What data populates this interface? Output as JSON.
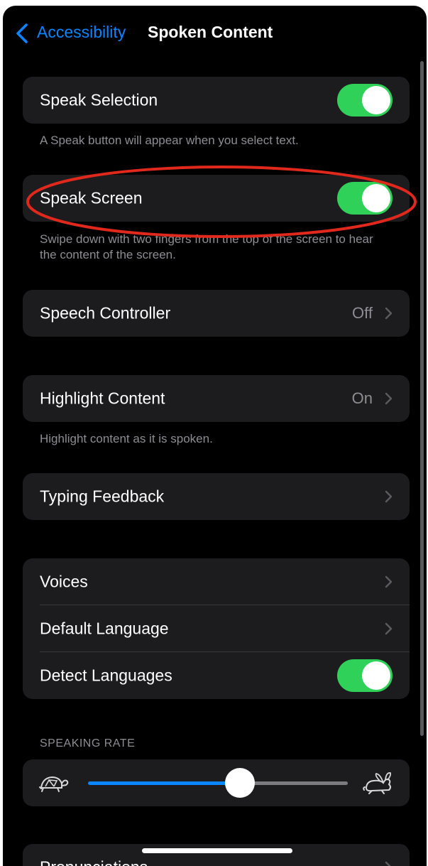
{
  "nav": {
    "back_label": "Accessibility",
    "title": "Spoken Content"
  },
  "speak_selection": {
    "label": "Speak Selection",
    "enabled": true,
    "footer": "A Speak button will appear when you select text."
  },
  "speak_screen": {
    "label": "Speak Screen",
    "enabled": true,
    "footer": "Swipe down with two fingers from the top of the screen to hear the content of the screen."
  },
  "speech_controller": {
    "label": "Speech Controller",
    "value": "Off"
  },
  "highlight_content": {
    "label": "Highlight Content",
    "value": "On",
    "footer": "Highlight content as it is spoken."
  },
  "typing_feedback": {
    "label": "Typing Feedback"
  },
  "voices_group": {
    "voices_label": "Voices",
    "default_language_label": "Default Language",
    "detect_languages_label": "Detect Languages",
    "detect_languages_enabled": true
  },
  "speaking_rate": {
    "header": "SPEAKING RATE",
    "value_fraction": 0.55
  },
  "pronunciations": {
    "label": "Pronunciations"
  },
  "colors": {
    "accent": "#0a84ff",
    "toggle_on": "#30d158",
    "highlight_ring": "#e0281c",
    "background": "#000000",
    "cell": "#1c1c1e"
  },
  "icons": [
    "chevron-left-icon",
    "chevron-right-icon",
    "turtle-icon",
    "rabbit-icon"
  ]
}
